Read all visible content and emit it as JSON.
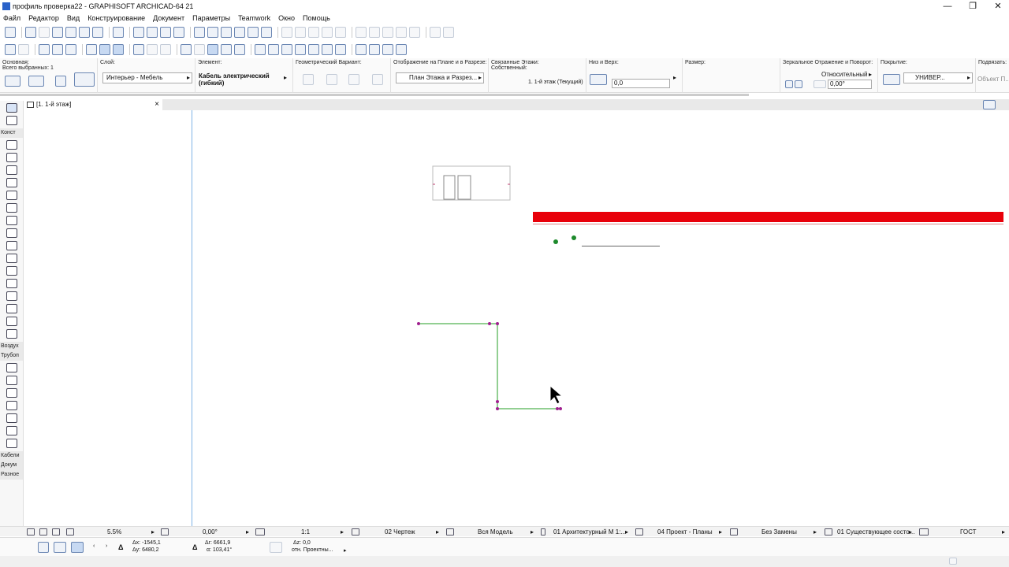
{
  "window": {
    "title": "профиль проверка22 - GRAPHISOFT ARCHICAD-64 21",
    "minimize": "—",
    "restore": "❐",
    "close": "✕"
  },
  "menu": [
    "Файл",
    "Редактор",
    "Вид",
    "Конструирование",
    "Документ",
    "Параметры",
    "Teamwork",
    "Окно",
    "Помощь"
  ],
  "infobox": {
    "main_label": "Основная:",
    "selected_count": "Всего выбранных: 1",
    "layer_label": "Слой:",
    "layer_value": "Интерьер - Мебель",
    "element_label": "Элемент:",
    "element_value_1": "Кабель электрический",
    "element_value_2": "(гибкий)",
    "geom_label": "Геометрический Вариант:",
    "display_label": "Отображение на Плане и в Разрезе:",
    "display_value": "План Этажа и Разрез...",
    "stories_label": "Связанные Этажи:",
    "stories_sub": "Собственный:",
    "stories_value": "1. 1-й этаж (Текущий)",
    "bottom_top_label": "Низ и Верх:",
    "bottom_value": "0,0",
    "size_label": "Размер:",
    "mirror_label": "Зеркальное Отражение и Поворот:",
    "mirror_mode": "Относительный",
    "angle_value": "0,00°",
    "cover_label": "Покрытие:",
    "cover_value": "УНИВЕР...",
    "sub_label": "Подвязать:",
    "sub_value": "Объект П..."
  },
  "toolbox": {
    "groups": [
      "Конст",
      "Воздух",
      "Трубоп",
      "Кабели",
      "Докум",
      "Разное"
    ]
  },
  "tab": {
    "label": "[1. 1-й этаж]",
    "close": "×"
  },
  "statusbar": {
    "zoom": "5.5%",
    "angle": "0,00°",
    "scale": "1:1",
    "drawing": "02 Чертеж",
    "model": "Вся Модель",
    "arch": "01 Архитектурный М 1:...",
    "project": "04 Проект - Планы",
    "override": "Без Замены",
    "renovation": "01 Существующее состо...",
    "standard": "ГОСТ"
  },
  "coords": {
    "ax": "Δx: -1545,1",
    "ay": "Δy: 6480,2",
    "ar": "Δr: 6661,9",
    "angle": "α: 103,41°",
    "az": "Δz: 0,0",
    "ref": "отн. Проектны..."
  },
  "colors": {
    "red_element": "#e8000a",
    "green_line": "#6fbf6f",
    "node": "#a0208f",
    "guide_line": "#7fb4e6"
  }
}
